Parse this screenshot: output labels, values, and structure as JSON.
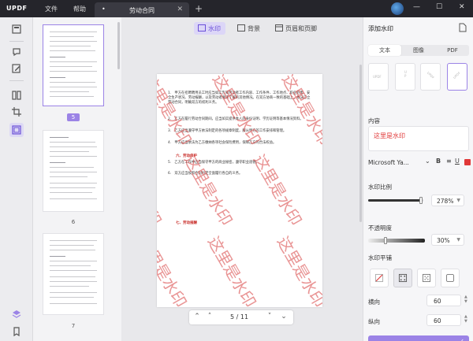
{
  "titlebar": {
    "logo": "UPDF",
    "menu": [
      "文件",
      "帮助"
    ],
    "tab_name": "劳动合同",
    "tab_icon": "dot-icon",
    "new_tab_label": "+"
  },
  "rail": {
    "icons": [
      "reader-icon",
      "comment-icon",
      "edit-icon",
      "organize-icon",
      "crop-icon",
      "watermark-icon",
      "stack-icon",
      "bookmark-icon"
    ]
  },
  "thumbnails": {
    "pages": [
      {
        "label": "5",
        "selected": true
      },
      {
        "label": "6",
        "selected": false
      },
      {
        "label": "7",
        "selected": false
      }
    ]
  },
  "toolbar": {
    "tabs": [
      {
        "label": "水印",
        "active": true
      },
      {
        "label": "背景",
        "active": false
      },
      {
        "label": "页眉和页脚",
        "active": false
      }
    ]
  },
  "document": {
    "paragraphs": [
      "1.　甲方在招聘聘用员工时应当如实告知劳动者工作内容、工作条件、工作地点、职业危害、安全生产状况、劳动报酬，以及劳动者要求了解的其他情况。在双方协商一致的基础上，依法订立劳动合同，明确双方的权利义务。",
      "2.　乙方在履行劳动合同期间，应当如实提供本人的身份证明、学历证明等基本情况资料。",
      "3.　乙方应当遵守甲方依法制定的各项规章制度，服从甲方的工作安排和管理。",
      "4.　甲方应当依法为乙方缴纳各项社会保险费用，保障乙方的合法权益。",
      "5.　乙方在工作中应当保守甲方的商业秘密，遵守职业道德。",
      "6.　双方应当按照合同约定全面履行各自的义务。"
    ],
    "heading1": "六、劳动保护",
    "heading2": "七、劳动报酬",
    "watermark_text": "这里是水印"
  },
  "pager": {
    "current": "5",
    "total": "11",
    "separator": "/"
  },
  "panel": {
    "title": "添加水印",
    "type_tabs": [
      {
        "label": "文本",
        "active": true
      },
      {
        "label": "图像",
        "active": false
      },
      {
        "label": "PDF",
        "active": false
      }
    ],
    "content_label": "内容",
    "content_value": "这里是水印",
    "font": "Microsoft Ya...",
    "text_color": "#e03838",
    "scale_label": "水印比例",
    "scale_value": "278%",
    "scale_fraction": 0.95,
    "opacity_label": "不透明度",
    "opacity_value": "30%",
    "opacity_fraction": 0.3,
    "tile_label": "水印平铺",
    "h_label": "横向",
    "h_value": "60",
    "v_label": "纵向",
    "v_value": "60",
    "accent": "#9b83e6"
  }
}
